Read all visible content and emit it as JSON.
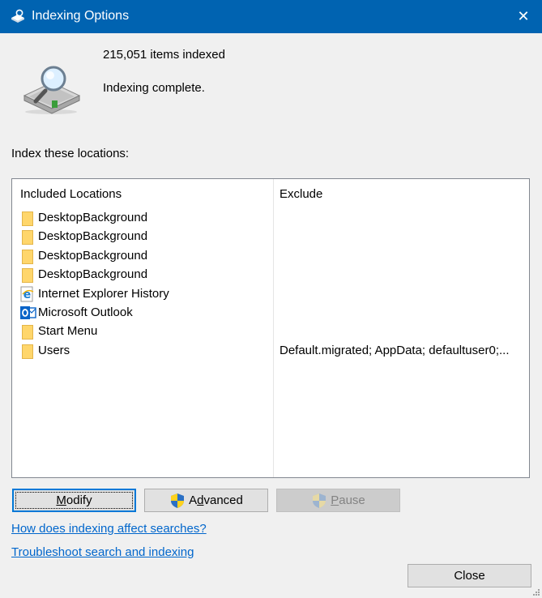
{
  "window": {
    "title": "Indexing Options",
    "title_icon": "indexing-options-icon",
    "close_glyph": "✕"
  },
  "status": {
    "items_indexed": "215,051 items indexed",
    "message": "Indexing complete."
  },
  "locations": {
    "label": "Index these locations:",
    "columns": {
      "included": "Included Locations",
      "exclude": "Exclude"
    },
    "rows": [
      {
        "name": "DesktopBackground",
        "icon": "folder-icon",
        "exclude": ""
      },
      {
        "name": "DesktopBackground",
        "icon": "folder-icon",
        "exclude": ""
      },
      {
        "name": "DesktopBackground",
        "icon": "folder-icon",
        "exclude": ""
      },
      {
        "name": "DesktopBackground",
        "icon": "folder-icon",
        "exclude": ""
      },
      {
        "name": "Internet Explorer History",
        "icon": "internet-explorer-icon",
        "exclude": ""
      },
      {
        "name": "Microsoft Outlook",
        "icon": "outlook-icon",
        "exclude": ""
      },
      {
        "name": "Start Menu",
        "icon": "folder-icon",
        "exclude": ""
      },
      {
        "name": "Users",
        "icon": "folder-icon",
        "exclude": "Default.migrated; AppData; defaultuser0;..."
      }
    ]
  },
  "buttons": {
    "modify": {
      "hotkey": "M",
      "rest": "odify"
    },
    "advanced": {
      "pre": "A",
      "hotkey": "d",
      "rest": "vanced"
    },
    "pause": {
      "hotkey": "P",
      "rest": "ause"
    },
    "close": "Close"
  },
  "links": {
    "how": "How does indexing affect searches?",
    "troubleshoot": "Troubleshoot search and indexing"
  },
  "colors": {
    "titlebar": "#0063b1",
    "link": "#0066cc",
    "default_button_border": "#0078d7"
  }
}
